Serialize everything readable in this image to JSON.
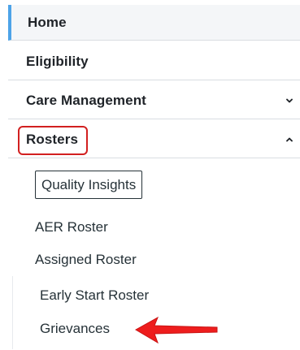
{
  "navigation": {
    "items": [
      {
        "label": "Home"
      },
      {
        "label": "Eligibility"
      },
      {
        "label": "Care Management"
      },
      {
        "label": "Rosters"
      }
    ],
    "rosters_submenu": [
      {
        "label": "Quality Insights"
      },
      {
        "label": "AER Roster"
      },
      {
        "label": "Assigned Roster"
      },
      {
        "label": "Early Start Roster"
      },
      {
        "label": "Grievances"
      }
    ]
  },
  "colors": {
    "accent": "#4da3e8",
    "highlight": "#d22020",
    "text": "#1f2328"
  },
  "icons": {
    "care_management_state": "chevron-down-icon",
    "rosters_state": "chevron-up-icon",
    "annotation": "red-arrow-icon"
  }
}
